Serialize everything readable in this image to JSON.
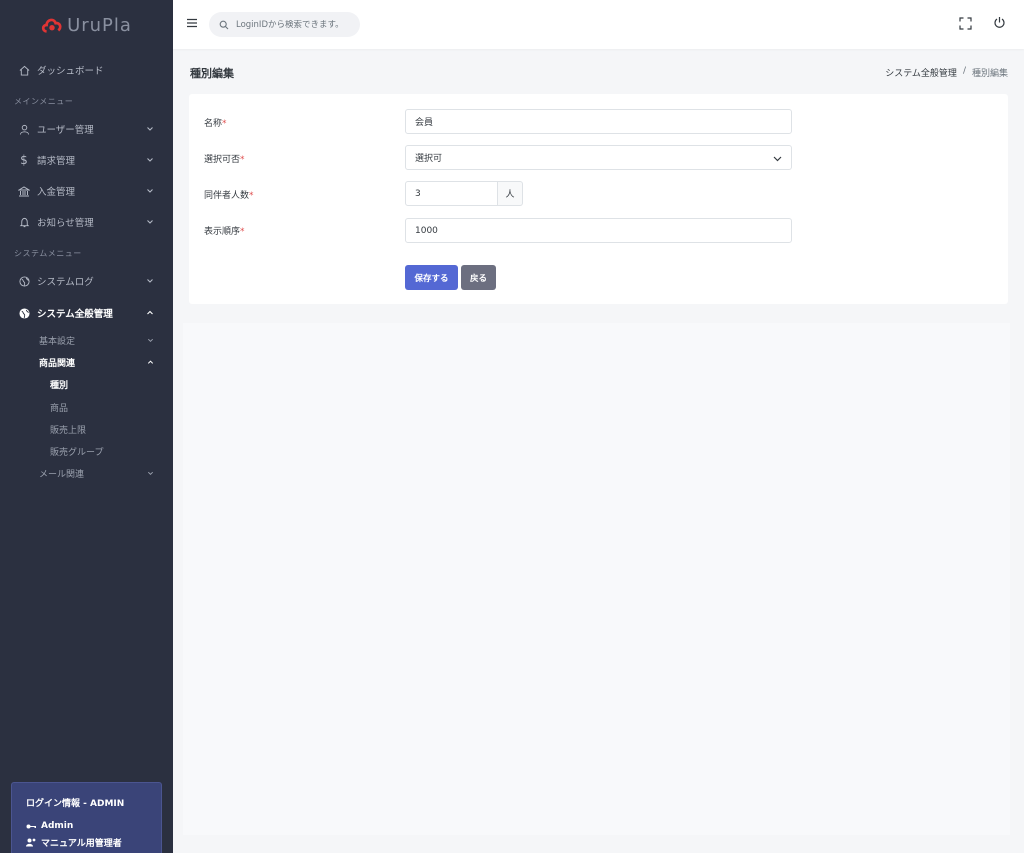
{
  "brand": {
    "name": "UruPla",
    "color": "#e03434"
  },
  "sidebar": {
    "dashboard": "ダッシュボード",
    "main_menu_title": "メインメニュー",
    "main_items": [
      {
        "label": "ユーザー管理",
        "icon": "user-icon"
      },
      {
        "label": "請求管理",
        "icon": "dollar-icon"
      },
      {
        "label": "入金管理",
        "icon": "bank-icon"
      },
      {
        "label": "お知らせ管理",
        "icon": "bell-icon"
      }
    ],
    "system_menu_title": "システムメニュー",
    "system_items": [
      {
        "label": "システムログ",
        "icon": "globe-icon"
      },
      {
        "label": "システム全般管理",
        "icon": "globe-icon",
        "active": true
      }
    ],
    "sub_items": {
      "basic": "基本設定",
      "product": "商品関連",
      "product_children": [
        "種別",
        "商品",
        "販売上限",
        "販売グループ"
      ],
      "mail": "メール関連"
    }
  },
  "login": {
    "title": "ログイン情報 - ADMIN",
    "user": "Admin",
    "role": "マニュアル用管理者"
  },
  "topbar": {
    "search_placeholder": "LoginIDから検索できます。"
  },
  "page": {
    "title": "種別編集",
    "breadcrumb_parent": "システム全般管理",
    "breadcrumb_sep": "/",
    "breadcrumb_current": "種別編集"
  },
  "form": {
    "name_label": "名称",
    "name_value": "会員",
    "select_label": "選択可否",
    "select_value": "選択可",
    "companion_label": "同伴者人数",
    "companion_value": "3",
    "companion_unit": "人",
    "order_label": "表示順序",
    "order_value": "1000",
    "required_mark": "*",
    "save": "保存する",
    "back": "戻る"
  },
  "colors": {
    "sidebar_bg": "#2b3040",
    "primary": "#5468d4",
    "secondary": "#6c6f80",
    "login_box": "#3a4478"
  }
}
